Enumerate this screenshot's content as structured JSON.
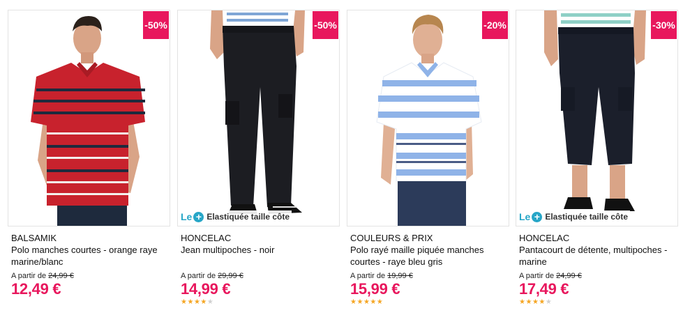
{
  "products": [
    {
      "discount": "-50%",
      "brand": "BALSAMIK",
      "title": "Polo manches courtes - orange raye marine/blanc",
      "from_label": "A partir de",
      "old_price": "24,99 €",
      "price": "12,49 €",
      "feature": null,
      "rating": null,
      "colors": {
        "top": "#c8222d",
        "bottom": "#1e2a3d",
        "stripe": "#f3f1ee"
      }
    },
    {
      "discount": "-50%",
      "brand": "HONCELAC",
      "title": "Jean multipoches - noir",
      "from_label": "A partir de",
      "old_price": "29,99 €",
      "price": "14,99 €",
      "feature": {
        "le": "Le",
        "icon": "plus-icon",
        "text": "Elastiquée taille côte"
      },
      "rating": 4,
      "colors": {
        "top": "#7fa6d6",
        "bottom": "#1c1d22",
        "stripe": "#ffffff"
      }
    },
    {
      "discount": "-20%",
      "brand": "COULEURS & PRIX",
      "title": "Polo rayé maille piquée manches courtes - raye bleu gris",
      "from_label": "A partir de",
      "old_price": "19,99 €",
      "price": "15,99 €",
      "feature": null,
      "rating": 5,
      "colors": {
        "top": "#8fb3e8",
        "bottom": "#2c3b5a",
        "stripe": "#ffffff"
      }
    },
    {
      "discount": "-30%",
      "brand": "HONCELAC",
      "title": "Pantacourt de détente, multipoches - marine",
      "from_label": "A partir de",
      "old_price": "24,99 €",
      "price": "17,49 €",
      "feature": {
        "le": "Le",
        "icon": "plus-icon",
        "text": "Elastiquée taille côte"
      },
      "rating": 4,
      "colors": {
        "top": "#8fd0c6",
        "bottom": "#1b1f2b",
        "stripe": "#ffffff"
      }
    }
  ],
  "accent_color": "#e8175d",
  "star_color": "#f5a623"
}
